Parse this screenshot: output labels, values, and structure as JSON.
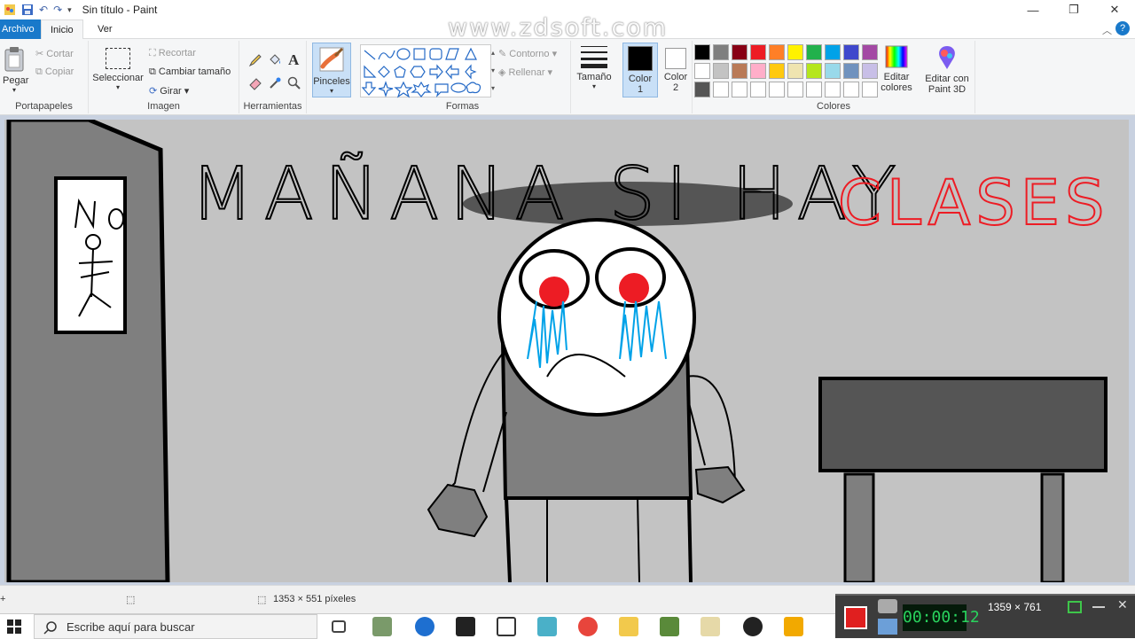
{
  "window": {
    "title": "Sin título - Paint"
  },
  "watermark": "www.zdsoft.com",
  "menu": {
    "archivo": "Archivo",
    "inicio": "Inicio",
    "ver": "Ver"
  },
  "portapapeles": {
    "pegar": "Pegar",
    "cortar": "Cortar",
    "copiar": "Copiar",
    "label": "Portapapeles"
  },
  "imagen": {
    "seleccionar": "Seleccionar",
    "recortar": "Recortar",
    "cambiar": "Cambiar tamaño",
    "girar": "Girar",
    "label": "Imagen"
  },
  "herramientas": {
    "label": "Herramientas",
    "text_glyph": "A"
  },
  "pinceles": "Pinceles",
  "formas": {
    "contorno": "Contorno",
    "rellenar": "Rellenar",
    "label": "Formas"
  },
  "tamano": "Tamaño",
  "color1": {
    "line1": "Color",
    "line2": "1",
    "value": "#000000"
  },
  "color2": {
    "line1": "Color",
    "line2": "2",
    "value": "#ffffff"
  },
  "colores": {
    "label": "Colores",
    "editar_line1": "Editar",
    "editar_line2": "colores",
    "palette_row1": [
      "#000000",
      "#7f7f7f",
      "#880015",
      "#ed1c24",
      "#ff7f27",
      "#fff200",
      "#22b14c",
      "#00a2e8",
      "#3f48cc",
      "#a349a4"
    ],
    "palette_row2": [
      "#ffffff",
      "#c3c3c3",
      "#b97a57",
      "#ffaec9",
      "#ffc90e",
      "#efe4b0",
      "#b5e61d",
      "#99d9ea",
      "#7092be",
      "#c8bfe7"
    ],
    "palette_row3": [
      "#555555",
      "#ffffff",
      "#ffffff",
      "#ffffff",
      "#ffffff",
      "#ffffff",
      "#ffffff",
      "#ffffff",
      "#ffffff",
      "#ffffff"
    ]
  },
  "paint3d": {
    "line1": "Editar con",
    "line2": "Paint 3D"
  },
  "drawing": {
    "headline": "MAÑANA SI HAY",
    "headline_red": "CLASES",
    "sign": "NO"
  },
  "status": {
    "dimensions": "1353 × 551 píxeles"
  },
  "taskbar": {
    "search_placeholder": "Escribe aquí para buscar"
  },
  "recorder": {
    "size": "1359 × 761",
    "timer": "00:00:12"
  }
}
